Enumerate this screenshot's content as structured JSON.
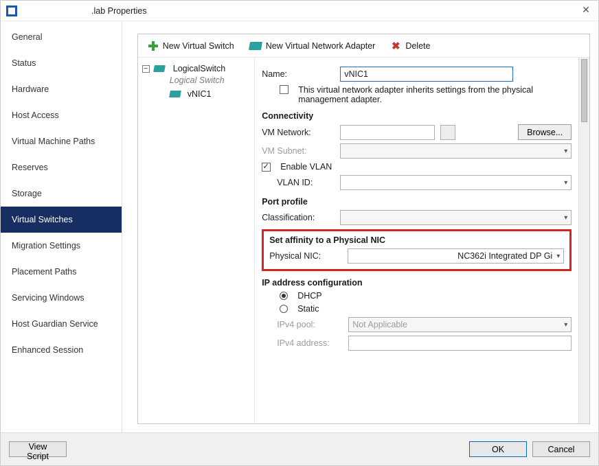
{
  "window": {
    "title": ".lab Properties"
  },
  "sidebar": {
    "items": [
      {
        "label": "General"
      },
      {
        "label": "Status"
      },
      {
        "label": "Hardware"
      },
      {
        "label": "Host Access"
      },
      {
        "label": "Virtual Machine Paths"
      },
      {
        "label": "Reserves"
      },
      {
        "label": "Storage"
      },
      {
        "label": "Virtual Switches"
      },
      {
        "label": "Migration Settings"
      },
      {
        "label": "Placement Paths"
      },
      {
        "label": "Servicing Windows"
      },
      {
        "label": "Host Guardian Service"
      },
      {
        "label": "Enhanced Session"
      }
    ],
    "selected_index": 7
  },
  "toolbar": {
    "new_switch": "New Virtual Switch",
    "new_adapter": "New Virtual Network Adapter",
    "delete": "Delete"
  },
  "tree": {
    "node_label": "LogicalSwitch",
    "node_subtitle": "Logical Switch",
    "child_label": "vNIC1"
  },
  "form": {
    "name_label": "Name:",
    "name_value": "vNIC1",
    "inherit_text": "This virtual network adapter inherits settings from the physical management adapter.",
    "connectivity_h": "Connectivity",
    "vm_network_label": "VM Network:",
    "vm_network_value": "",
    "browse_btn": "Browse...",
    "vm_subnet_label": "VM Subnet:",
    "enable_vlan_label": "Enable VLAN",
    "vlan_id_label": "VLAN ID:",
    "vlan_id_value": "",
    "port_profile_h": "Port profile",
    "classification_label": "Classification:",
    "classification_value": "",
    "affinity_h": "Set affinity to a Physical NIC",
    "physical_nic_label": "Physical NIC:",
    "physical_nic_value": "NC362i Integrated DP Gi",
    "ip_h": "IP address configuration",
    "dhcp_label": "DHCP",
    "static_label": "Static",
    "ipv4_pool_label": "IPv4 pool:",
    "ipv4_pool_value": "Not Applicable",
    "ipv4_addr_label": "IPv4 address:",
    "ipv4_addr_value": ""
  },
  "footer": {
    "view_script": "View Script",
    "ok": "OK",
    "cancel": "Cancel"
  }
}
